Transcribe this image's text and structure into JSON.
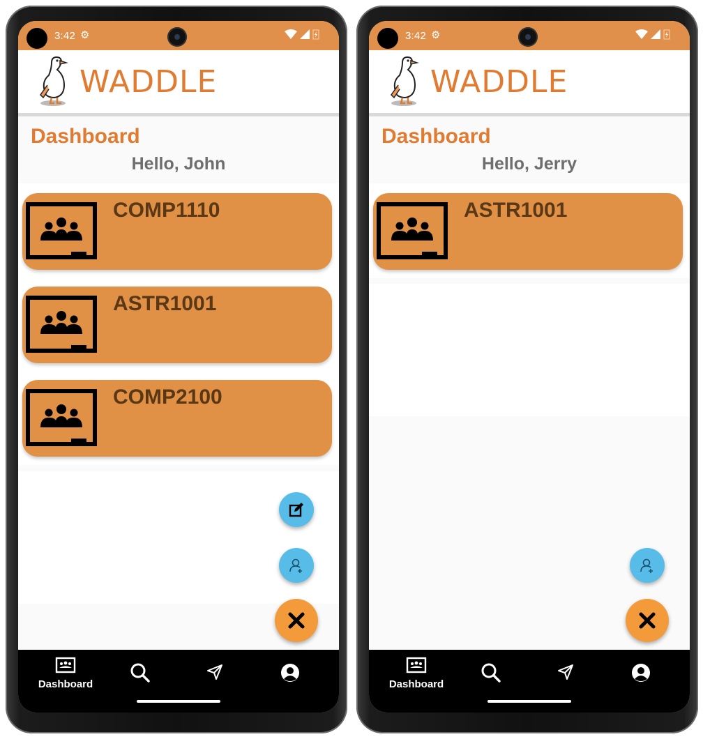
{
  "status": {
    "time": "3:42"
  },
  "app": {
    "brand": "WADDLE"
  },
  "screens": [
    {
      "title": "Dashboard",
      "greeting": "Hello, John",
      "courses": [
        "COMP1110",
        "ASTR1001",
        "COMP2100"
      ],
      "fabs": [
        "edit-icon",
        "add-user-icon",
        "close-icon"
      ]
    },
    {
      "title": "Dashboard",
      "greeting": "Hello, Jerry",
      "courses": [
        "ASTR1001"
      ],
      "fabs": [
        "add-user-icon",
        "close-icon"
      ]
    }
  ],
  "nav": {
    "dashboard_label": "Dashboard"
  },
  "colors": {
    "accent": "#e07b32",
    "status_bar": "#e0904a",
    "card": "#e19146",
    "fab_small": "#57bde8",
    "fab_big": "#f39a3a"
  }
}
